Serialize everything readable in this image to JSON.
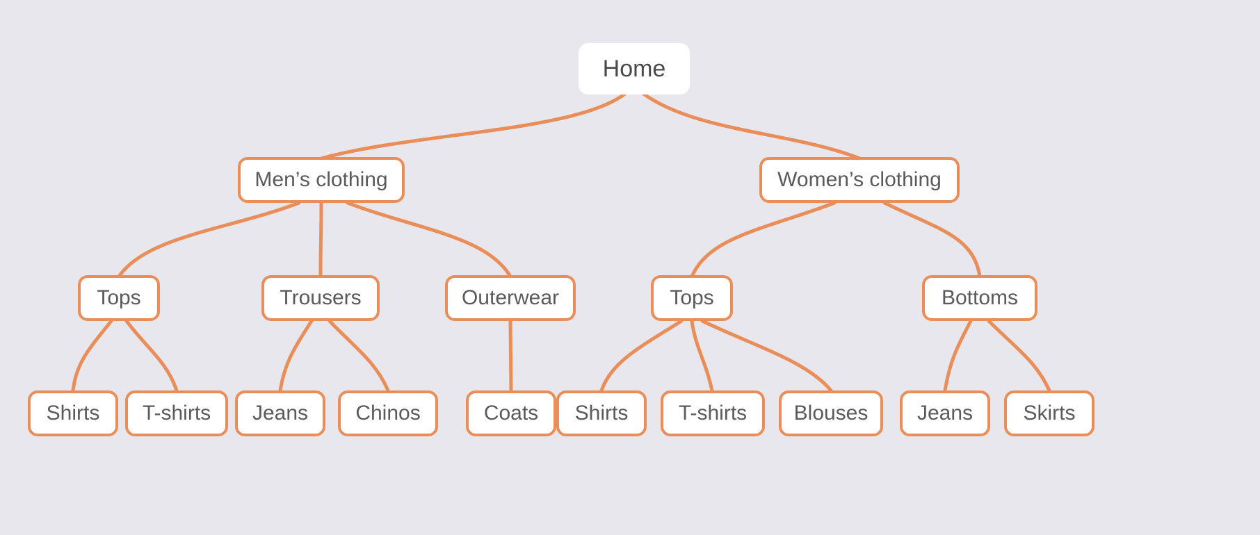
{
  "tree": {
    "root": {
      "label": "Home"
    },
    "men": {
      "label": "Men’s clothing",
      "tops": {
        "label": "Tops",
        "shirts": "Shirts",
        "tshirts": "T-shirts"
      },
      "trousers": {
        "label": "Trousers",
        "jeans": "Jeans",
        "chinos": "Chinos"
      },
      "outerwear": {
        "label": "Outerwear",
        "coats": "Coats"
      }
    },
    "women": {
      "label": "Women’s clothing",
      "tops": {
        "label": "Tops",
        "shirts": "Shirts",
        "tshirts": "T-shirts",
        "blouses": "Blouses"
      },
      "bottoms": {
        "label": "Bottoms",
        "jeans": "Jeans",
        "skirts": "Skirts"
      }
    }
  },
  "colors": {
    "edge": "#e98e58",
    "node_border": "#e98e58",
    "node_bg": "#ffffff",
    "page_bg": "#e9e7ee",
    "text": "#5a5a5a"
  }
}
